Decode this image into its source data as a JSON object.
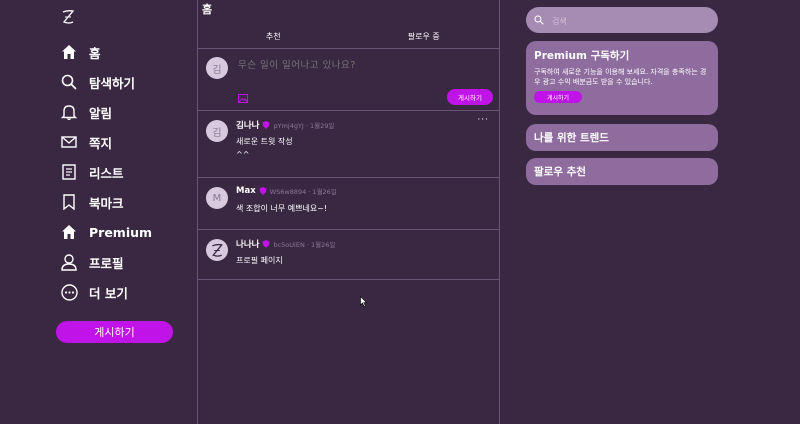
{
  "sidebar": {
    "logo_icon": "stylized-z-logo",
    "items": [
      {
        "label": "홈",
        "icon": "home-icon"
      },
      {
        "label": "탐색하기",
        "icon": "search-icon"
      },
      {
        "label": "알림",
        "icon": "bell-icon"
      },
      {
        "label": "쪽지",
        "icon": "mail-icon"
      },
      {
        "label": "리스트",
        "icon": "list-icon"
      },
      {
        "label": "북마크",
        "icon": "bookmark-icon"
      },
      {
        "label": "Premium",
        "icon": "premium-icon"
      },
      {
        "label": "프로필",
        "icon": "user-icon"
      },
      {
        "label": "더 보기",
        "icon": "more-icon"
      }
    ],
    "post_button": "게시하기"
  },
  "main": {
    "title": "홈",
    "tabs": [
      {
        "label": "추천"
      },
      {
        "label": "팔로우 중"
      }
    ],
    "compose": {
      "avatar": "김",
      "placeholder": "무슨 일이 일어나고 있나요?",
      "post_button": "게시하기"
    },
    "posts": [
      {
        "avatar": "김",
        "name": "김나나",
        "handle": "pYmj4gYJ · 1월29일",
        "body": "새로운 트윗 작성\n^^",
        "more": "···"
      },
      {
        "avatar": "M",
        "name": "Max",
        "handle": "WS6w8894 · 1월26일",
        "body": "색 조합이 너무 예쁘네요~!"
      },
      {
        "avatar": "Z",
        "name": "나나나",
        "handle": "bc5oUiEN · 1월26일",
        "body": "프로필 페이지"
      }
    ]
  },
  "right": {
    "search_placeholder": "검색",
    "premium": {
      "title": "Premium 구독하기",
      "desc": "구독하여 새로운 기능을 이용해 보세요. 자격을 충족하는 경우 광고 수익 배분금도 받을 수 있습니다.",
      "button": "게시하기"
    },
    "trends_title": "나를 위한 트렌드",
    "follow_title": "팔로우 추천"
  },
  "colors": {
    "background": "#3a2843",
    "accent": "#c013e8",
    "card": "#8f6c9e",
    "verified": "#c013e8"
  }
}
